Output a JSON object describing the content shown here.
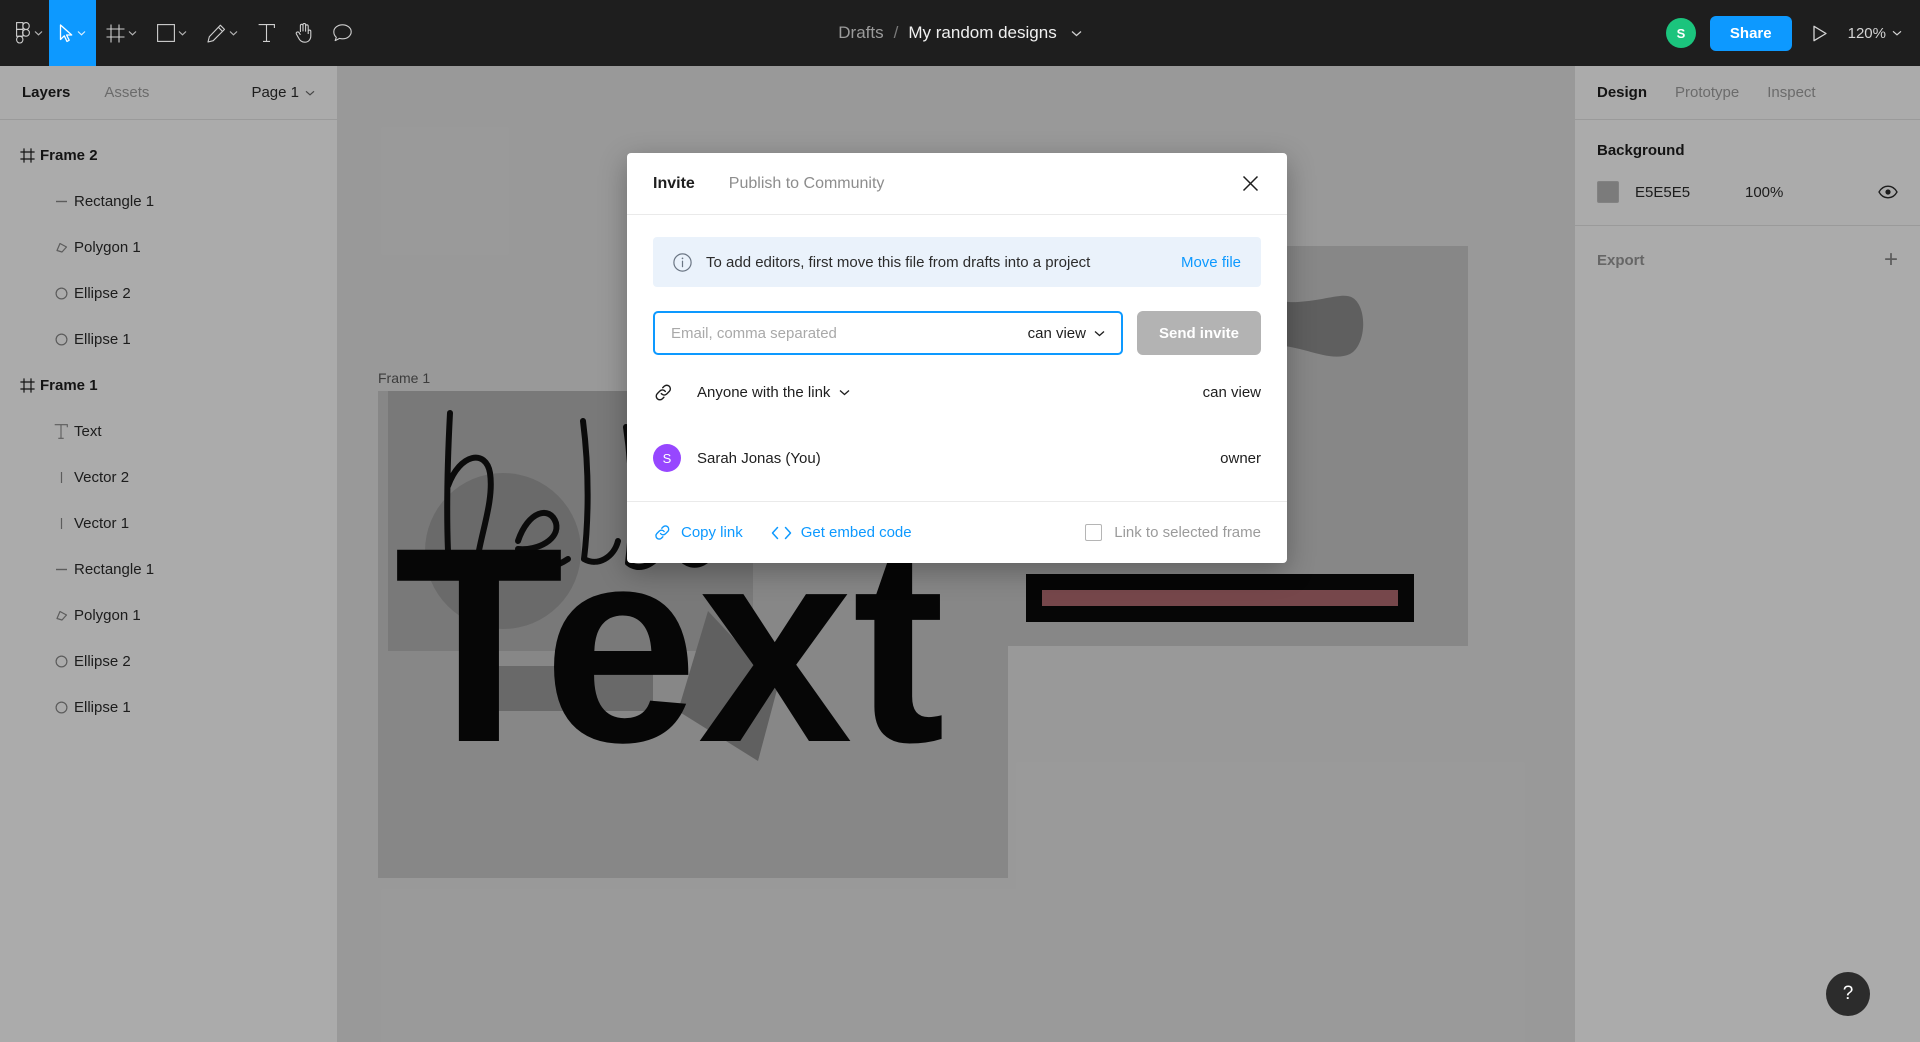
{
  "toolbar": {
    "tools": [
      {
        "name": "figma-logo-icon",
        "label": "Figma"
      },
      {
        "name": "move-tool",
        "label": "Move"
      },
      {
        "name": "frame-tool",
        "label": "Frame"
      },
      {
        "name": "shape-tool",
        "label": "Rectangle"
      },
      {
        "name": "pen-tool",
        "label": "Pen"
      },
      {
        "name": "text-tool",
        "label": "Text"
      },
      {
        "name": "hand-tool",
        "label": "Hand"
      },
      {
        "name": "comment-tool",
        "label": "Comment"
      }
    ],
    "breadcrumb_project": "Drafts",
    "breadcrumb_separator": "/",
    "file_name": "My random designs",
    "avatar_initial": "S",
    "share_label": "Share",
    "zoom_level": "120%"
  },
  "left_panel": {
    "tab_layers": "Layers",
    "tab_assets": "Assets",
    "page_name": "Page 1",
    "layers": [
      {
        "label": "Frame 2",
        "icon": "frame-icon",
        "depth": 0
      },
      {
        "label": "Rectangle 1",
        "icon": "rectangle-icon",
        "depth": 1
      },
      {
        "label": "Polygon 1",
        "icon": "polygon-icon",
        "depth": 1
      },
      {
        "label": "Ellipse 2",
        "icon": "ellipse-icon",
        "depth": 1
      },
      {
        "label": "Ellipse 1",
        "icon": "ellipse-icon",
        "depth": 1
      },
      {
        "label": "Frame 1",
        "icon": "frame-icon",
        "depth": 0
      },
      {
        "label": "Text",
        "icon": "text-icon",
        "depth": 1
      },
      {
        "label": "Vector 2",
        "icon": "vector-icon",
        "depth": 1
      },
      {
        "label": "Vector 1",
        "icon": "vector-icon",
        "depth": 1
      },
      {
        "label": "Rectangle 1",
        "icon": "rectangle-icon",
        "depth": 1
      },
      {
        "label": "Polygon 1",
        "icon": "polygon-icon",
        "depth": 1
      },
      {
        "label": "Ellipse 2",
        "icon": "ellipse-icon",
        "depth": 1
      },
      {
        "label": "Ellipse 1",
        "icon": "ellipse-icon",
        "depth": 1
      }
    ]
  },
  "canvas": {
    "frame1_label": "Frame 1",
    "frame1_text": "Text",
    "frame1_script": "hello"
  },
  "right_panel": {
    "tab_design": "Design",
    "tab_prototype": "Prototype",
    "tab_inspect": "Inspect",
    "background_title": "Background",
    "background_hex": "E5E5E5",
    "background_opacity": "100%",
    "export_title": "Export"
  },
  "modal": {
    "tab_invite": "Invite",
    "tab_publish": "Publish to Community",
    "notice_text": "To add editors, first move this file from drafts into a project",
    "notice_link": "Move file",
    "email_placeholder": "Email, comma separated",
    "email_value": "",
    "permission_selected": "can view",
    "send_invite_label": "Send invite",
    "link_access_label": "Anyone with the link",
    "link_access_permission": "can view",
    "member_name": "Sarah Jonas (You)",
    "member_initial": "S",
    "member_role": "owner",
    "copy_link_label": "Copy link",
    "embed_code_label": "Get embed code",
    "link_frame_label": "Link to selected frame"
  },
  "help": {
    "label": "?"
  },
  "colors": {
    "accent_blue": "#0d99ff",
    "avatar_green": "#1bc47d",
    "avatar_purple": "#9747ff",
    "canvas_bg": "#e5e5e5"
  }
}
